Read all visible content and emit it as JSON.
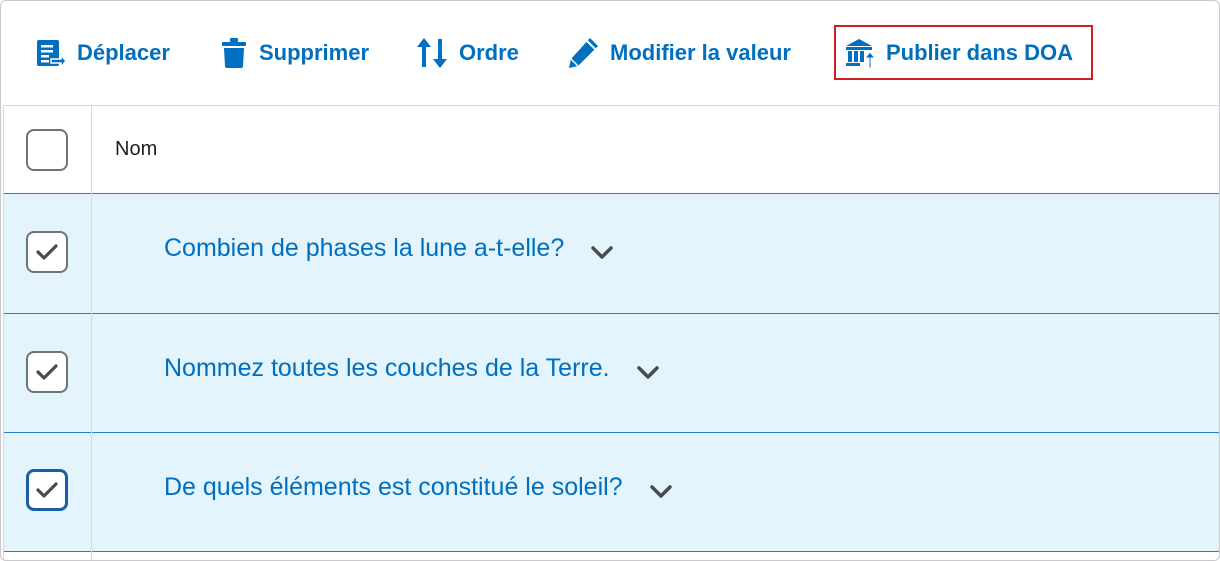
{
  "toolbar": {
    "move_label": "Déplacer",
    "delete_label": "Supprimer",
    "order_label": "Ordre",
    "edit_value_label": "Modifier la valeur",
    "publish_label": "Publier dans DOA"
  },
  "table": {
    "header_name": "Nom",
    "rows": [
      {
        "text": "Combien de phases la lune a-t-elle?",
        "checked": true
      },
      {
        "text": "Nommez toutes les couches de la Terre.",
        "checked": true
      },
      {
        "text": "De quels éléments est constitué le soleil?",
        "checked": true
      }
    ]
  },
  "colors": {
    "accent": "#006fbf",
    "selected_row_bg": "#e3f4fc",
    "highlight_border": "#cd2026"
  }
}
